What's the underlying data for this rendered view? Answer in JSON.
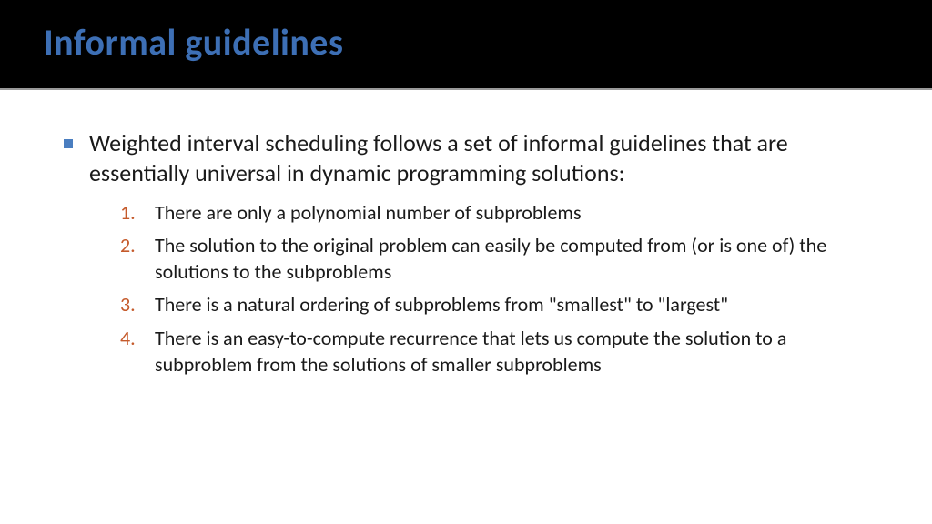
{
  "title": "Informal guidelines",
  "bullet": {
    "text": "Weighted interval scheduling follows a set of informal guidelines that are essentially universal in dynamic programming solutions:"
  },
  "numbered_items": [
    {
      "number": "1.",
      "text": "There are only a polynomial number of subproblems"
    },
    {
      "number": "2.",
      "text": "The solution to the original problem can easily be computed from (or is one of) the solutions to the subproblems"
    },
    {
      "number": "3.",
      "text": "There is a natural ordering of subproblems from \"smallest\" to \"largest\""
    },
    {
      "number": "4.",
      "text": "There is an easy-to-compute recurrence that lets us compute the solution to a subproblem from the solutions of smaller subproblems"
    }
  ]
}
